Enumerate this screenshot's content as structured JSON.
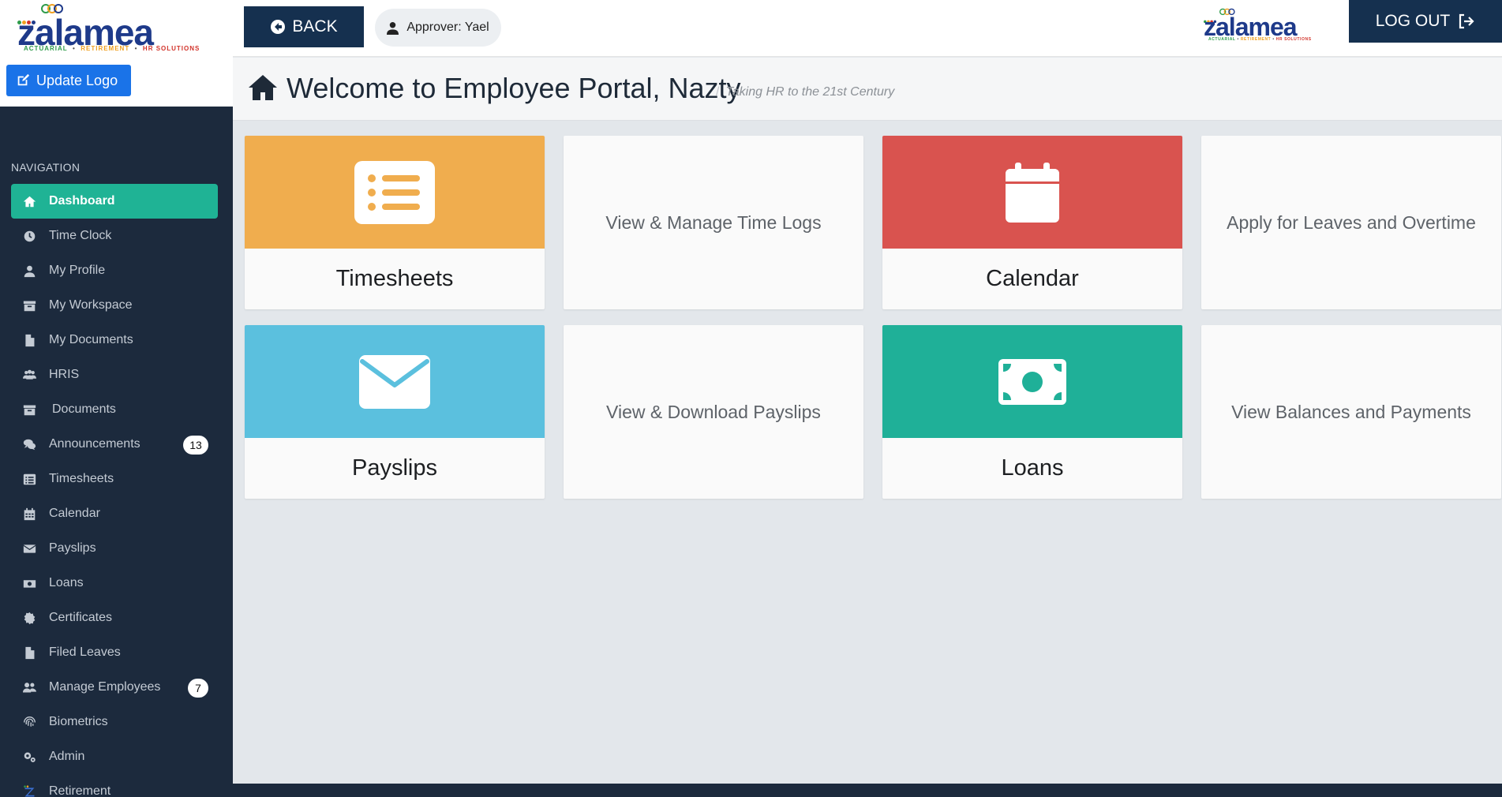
{
  "brand": {
    "name": "zalamea",
    "tagline": [
      "ACTUARIAL",
      "RETIREMENT",
      "HR SOLUTIONS"
    ],
    "tagline_colors": [
      "#2e9b4a",
      "#f0a020",
      "#d2332a"
    ],
    "word_color": "#1e3a8a"
  },
  "sidebar": {
    "update_logo_label": "Update Logo",
    "nav_title": "NAVIGATION",
    "items": [
      {
        "label": "Dashboard",
        "icon": "home-icon",
        "active": true
      },
      {
        "label": "Time Clock",
        "icon": "clock-icon"
      },
      {
        "label": "My Profile",
        "icon": "user-icon"
      },
      {
        "label": "My Workspace",
        "icon": "archive-icon"
      },
      {
        "label": "My Documents",
        "icon": "file-icon"
      },
      {
        "label": "HRIS",
        "icon": "users-icon"
      },
      {
        "label": "Documents",
        "icon": "archive-icon"
      },
      {
        "label": "Announcements",
        "icon": "comments-icon",
        "badge": "13"
      },
      {
        "label": "Timesheets",
        "icon": "list-icon"
      },
      {
        "label": "Calendar",
        "icon": "calendar-icon"
      },
      {
        "label": "Payslips",
        "icon": "envelope-icon"
      },
      {
        "label": "Loans",
        "icon": "money-icon"
      },
      {
        "label": "Certificates",
        "icon": "certificate-icon"
      },
      {
        "label": "Filed Leaves",
        "icon": "file-icon"
      },
      {
        "label": "Manage Employees",
        "icon": "users-icon",
        "badge": "7"
      },
      {
        "label": "Biometrics",
        "icon": "fingerprint-icon"
      },
      {
        "label": "Admin",
        "icon": "cogs-icon"
      },
      {
        "label": "Retirement",
        "icon": "zalamea-icon"
      }
    ]
  },
  "topbar": {
    "back_label": "BACK",
    "approver_label": "Approver: Yael",
    "logout_label": "LOG OUT"
  },
  "header": {
    "title": "Welcome to Employee Portal, Nazty",
    "separator": "/",
    "subtitle": "Taking HR to the 21st Century"
  },
  "cards": [
    {
      "title": "Timesheets",
      "icon": "list-icon",
      "color": "#f0ad4e"
    },
    {
      "description": "View & Manage Time Logs"
    },
    {
      "title": "Calendar",
      "icon": "calendar-icon",
      "color": "#d9534f"
    },
    {
      "description": "Apply for Leaves and Overtime"
    },
    {
      "title": "Payslips",
      "icon": "envelope-icon",
      "color": "#5bc0de"
    },
    {
      "description": "View & Download Payslips"
    },
    {
      "title": "Loans",
      "icon": "money-icon",
      "color": "#1fb098"
    },
    {
      "description": "View Balances and Payments"
    }
  ],
  "colors": {
    "sidebar_bg": "#1c2a3d",
    "accent_active": "#1fb395",
    "navy_button": "#15304f",
    "blue_button": "#1a73e8"
  }
}
